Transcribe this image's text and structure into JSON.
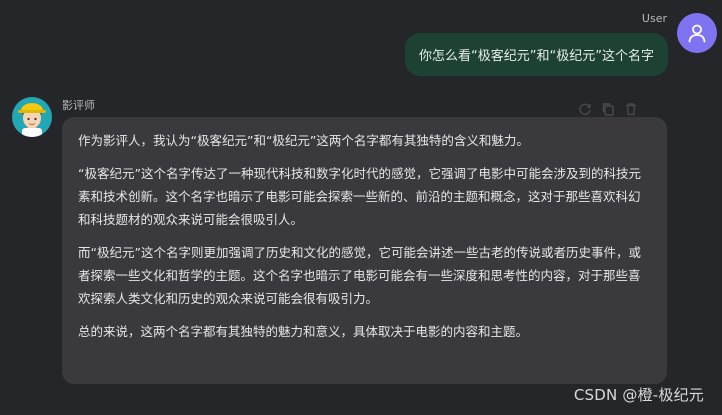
{
  "user": {
    "name": "User",
    "avatar_icon": "person-icon",
    "message": "你怎么看“极客纪元”和“极纪元”这个名字"
  },
  "bot": {
    "name": "影评师",
    "avatar_icon": "cartoon-character-avatar",
    "actions": [
      "refresh-icon",
      "copy-icon",
      "trash-icon"
    ],
    "paragraphs": [
      "作为影评人，我认为“极客纪元”和“极纪元”这两个名字都有其独特的含义和魅力。",
      "“极客纪元”这个名字传达了一种现代科技和数字化时代的感觉，它强调了电影中可能会涉及到的科技元素和技术创新。这个名字也暗示了电影可能会探索一些新的、前沿的主题和概念，这对于那些喜欢科幻和科技题材的观众来说可能会很吸引人。",
      "而“极纪元”这个名字则更加强调了历史和文化的感觉，它可能会讲述一些古老的传说或者历史事件，或者探索一些文化和哲学的主题。这个名字也暗示了电影可能会有一些深度和思考性的内容，对于那些喜欢探索人类文化和历史的观众来说可能会很有吸引力。",
      "总的来说，这两个名字都有其独特的魅力和意义，具体取决于电影的内容和主题。"
    ]
  },
  "watermark": "CSDN @橙-极纪元",
  "colors": {
    "background": "#25262a",
    "user_bubble": "#1d4233",
    "bot_bubble": "#3a3a3e",
    "user_avatar": "#7f73f2"
  }
}
